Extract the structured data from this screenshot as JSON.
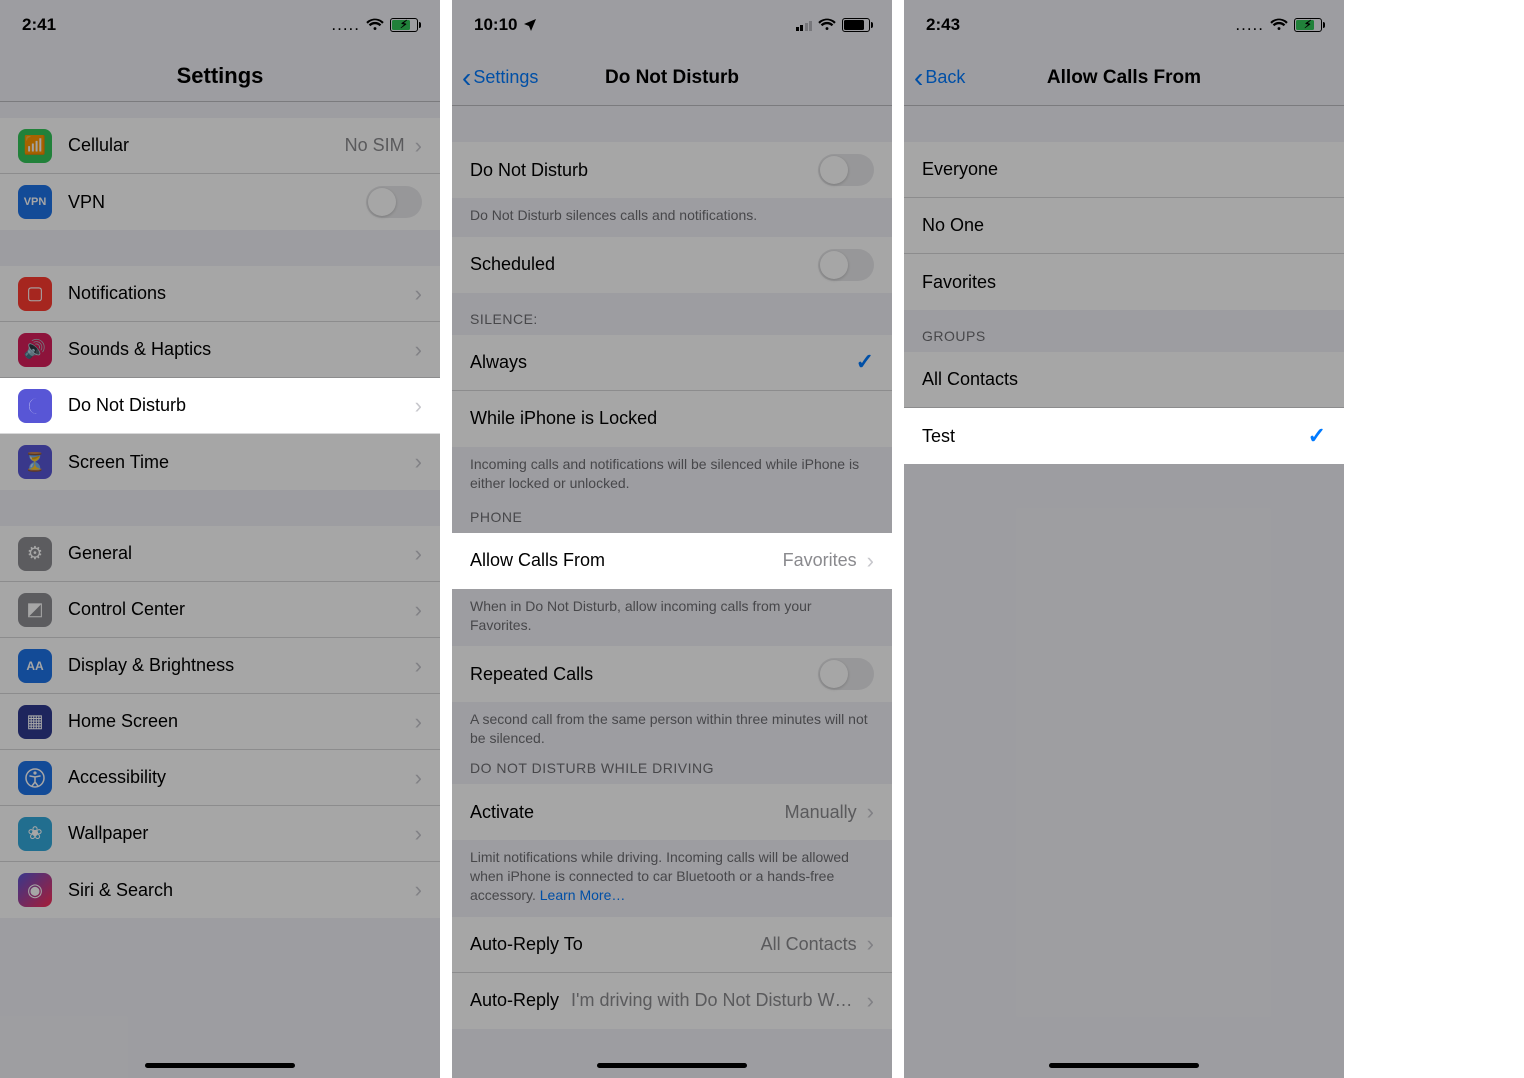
{
  "screens": {
    "settings": {
      "time": "2:41",
      "dots": ".....",
      "title": "Settings",
      "rows": {
        "cellular": {
          "label": "Cellular",
          "detail": "No SIM"
        },
        "vpn": {
          "label": "VPN"
        },
        "notifications": {
          "label": "Notifications"
        },
        "sounds": {
          "label": "Sounds & Haptics"
        },
        "dnd": {
          "label": "Do Not Disturb"
        },
        "screentime": {
          "label": "Screen Time"
        },
        "general": {
          "label": "General"
        },
        "controlcenter": {
          "label": "Control Center"
        },
        "display": {
          "label": "Display & Brightness"
        },
        "homescreen": {
          "label": "Home Screen"
        },
        "accessibility": {
          "label": "Accessibility"
        },
        "wallpaper": {
          "label": "Wallpaper"
        },
        "siri": {
          "label": "Siri & Search"
        }
      }
    },
    "dnd": {
      "time": "10:10",
      "back": "Settings",
      "title": "Do Not Disturb",
      "rows": {
        "dnd_toggle": {
          "label": "Do Not Disturb"
        },
        "dnd_toggle_footer": "Do Not Disturb silences calls and notifications.",
        "scheduled": {
          "label": "Scheduled"
        },
        "silence_header": "SILENCE:",
        "always": {
          "label": "Always"
        },
        "locked": {
          "label": "While iPhone is Locked"
        },
        "silence_footer": "Incoming calls and notifications will be silenced while iPhone is either locked or unlocked.",
        "phone_header": "PHONE",
        "allow_calls": {
          "label": "Allow Calls From",
          "detail": "Favorites"
        },
        "allow_calls_footer": "When in Do Not Disturb, allow incoming calls from your Favorites.",
        "repeated": {
          "label": "Repeated Calls"
        },
        "repeated_footer": "A second call from the same person within three minutes will not be silenced.",
        "driving_header": "DO NOT DISTURB WHILE DRIVING",
        "activate": {
          "label": "Activate",
          "detail": "Manually"
        },
        "activate_footer_text": "Limit notifications while driving. Incoming calls will be allowed when iPhone is connected to car Bluetooth or a hands-free accessory. ",
        "activate_footer_link": "Learn More…",
        "autoreply_to": {
          "label": "Auto-Reply To",
          "detail": "All Contacts"
        },
        "autoreply": {
          "label": "Auto-Reply",
          "detail": "I'm driving with Do Not Disturb While Dri…"
        }
      }
    },
    "allow": {
      "time": "2:43",
      "back": "Back",
      "title": "Allow Calls From",
      "dots": ".....",
      "rows": {
        "everyone": "Everyone",
        "noone": "No One",
        "favorites": "Favorites",
        "groups_header": "GROUPS",
        "all_contacts": "All Contacts",
        "test": "Test"
      }
    }
  }
}
